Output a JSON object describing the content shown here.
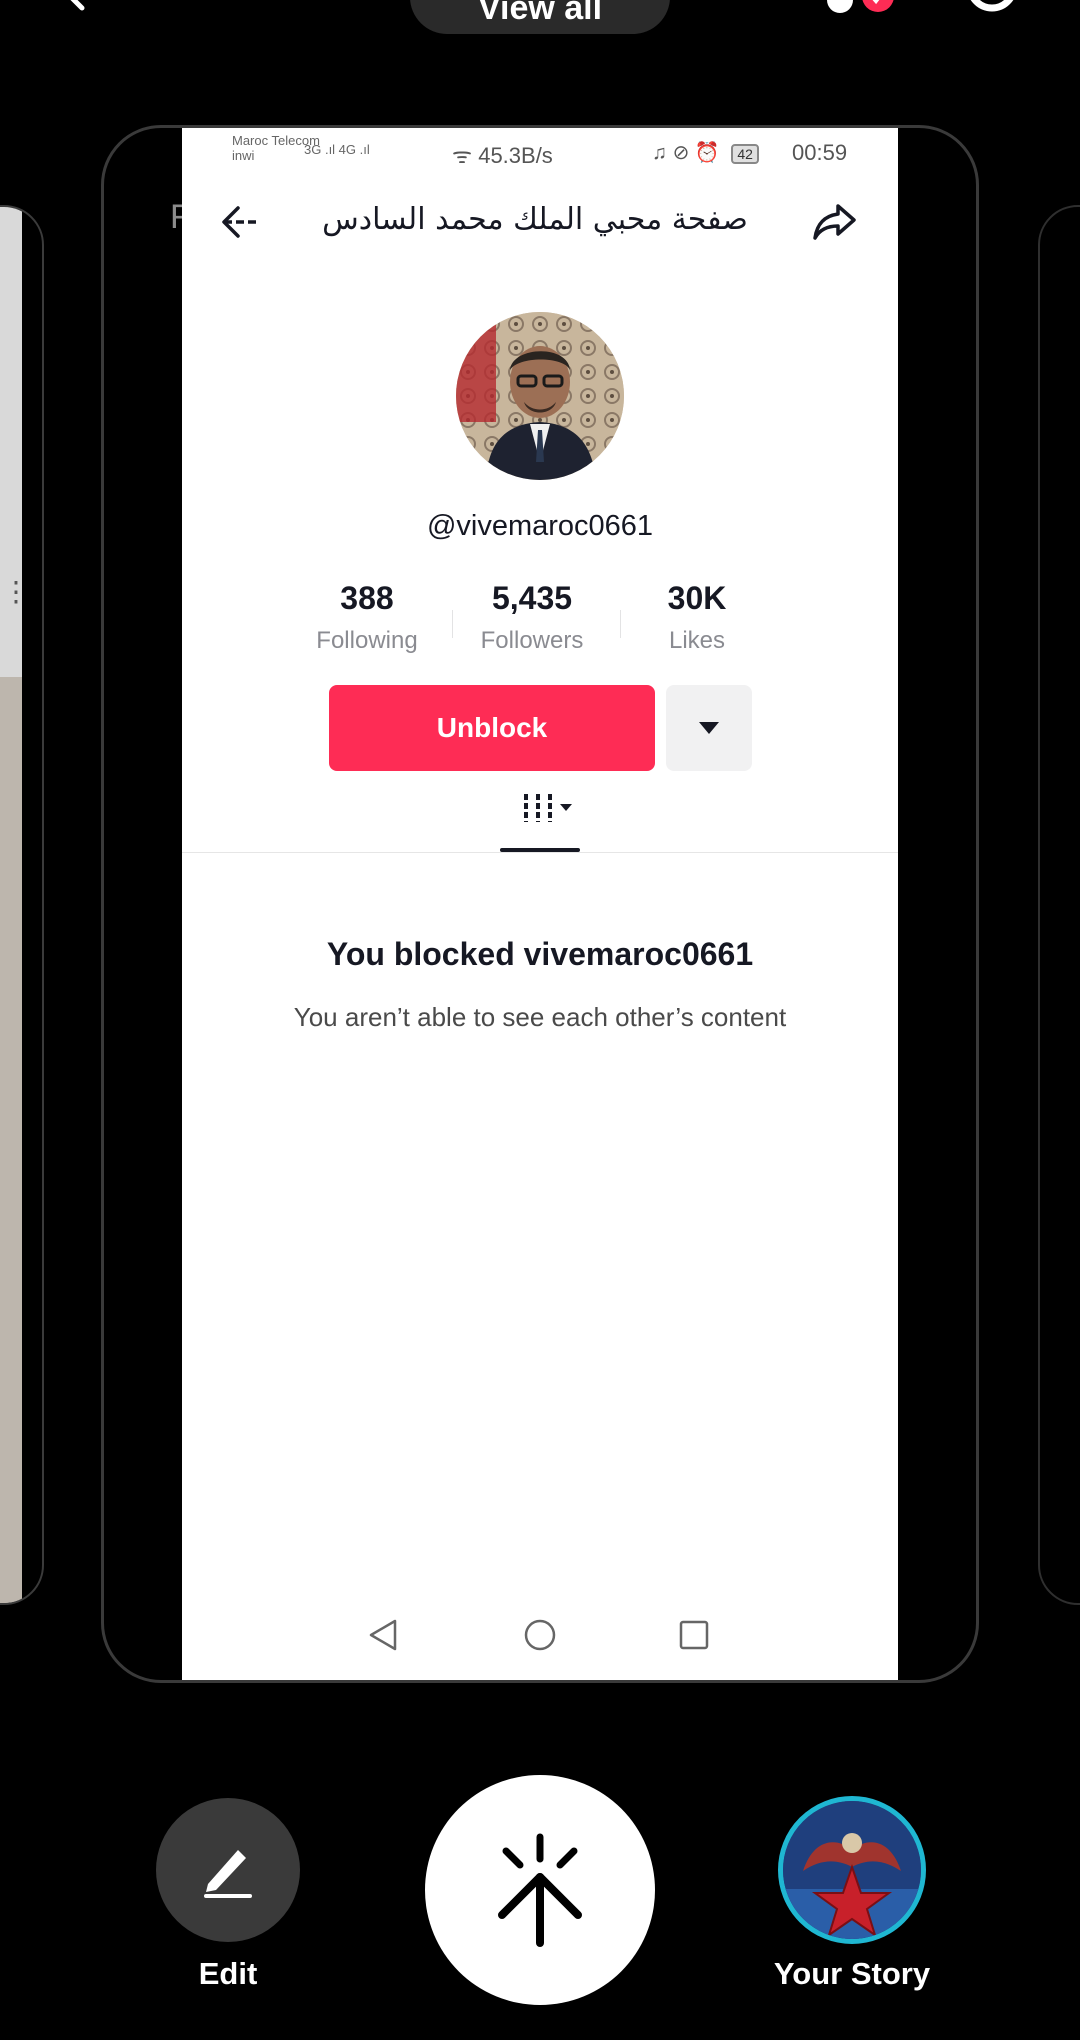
{
  "top_bar": {
    "view_all_label": "View all"
  },
  "ghost_left": {
    "partial_letter": "F"
  },
  "status_bar": {
    "carrier_line1": "Maroc Telecom",
    "carrier_line2": "inwi",
    "signal_text": "3G .ıl 4G .ıl",
    "net_speed": "45.3B/s",
    "battery": "42",
    "time": "00:59"
  },
  "header": {
    "title": "صفحة محبي الملك محمد السادس"
  },
  "profile": {
    "username": "@vivemaroc0661",
    "stats": [
      {
        "value": "388",
        "label": "Following"
      },
      {
        "value": "5,435",
        "label": "Followers"
      },
      {
        "value": "30K",
        "label": "Likes"
      }
    ],
    "unblock_label": "Unblock",
    "blocked_title": "You blocked vivemaroc0661",
    "blocked_subtitle": "You aren’t able to see each other’s content"
  },
  "bottom": {
    "edit_label": "Edit",
    "story_label": "Your Story"
  },
  "colors": {
    "accent": "#fe2c55",
    "story_ring": "#1fb7d2"
  },
  "icons": [
    "chevron-left-icon",
    "music-note-icon",
    "gear-icon",
    "arrow-left-icon",
    "share-arrow-icon",
    "caret-down-icon",
    "grid-filter-icon",
    "nav-back-icon",
    "nav-home-icon",
    "nav-recent-icon",
    "pencil-icon",
    "share-sparkle-icon"
  ]
}
